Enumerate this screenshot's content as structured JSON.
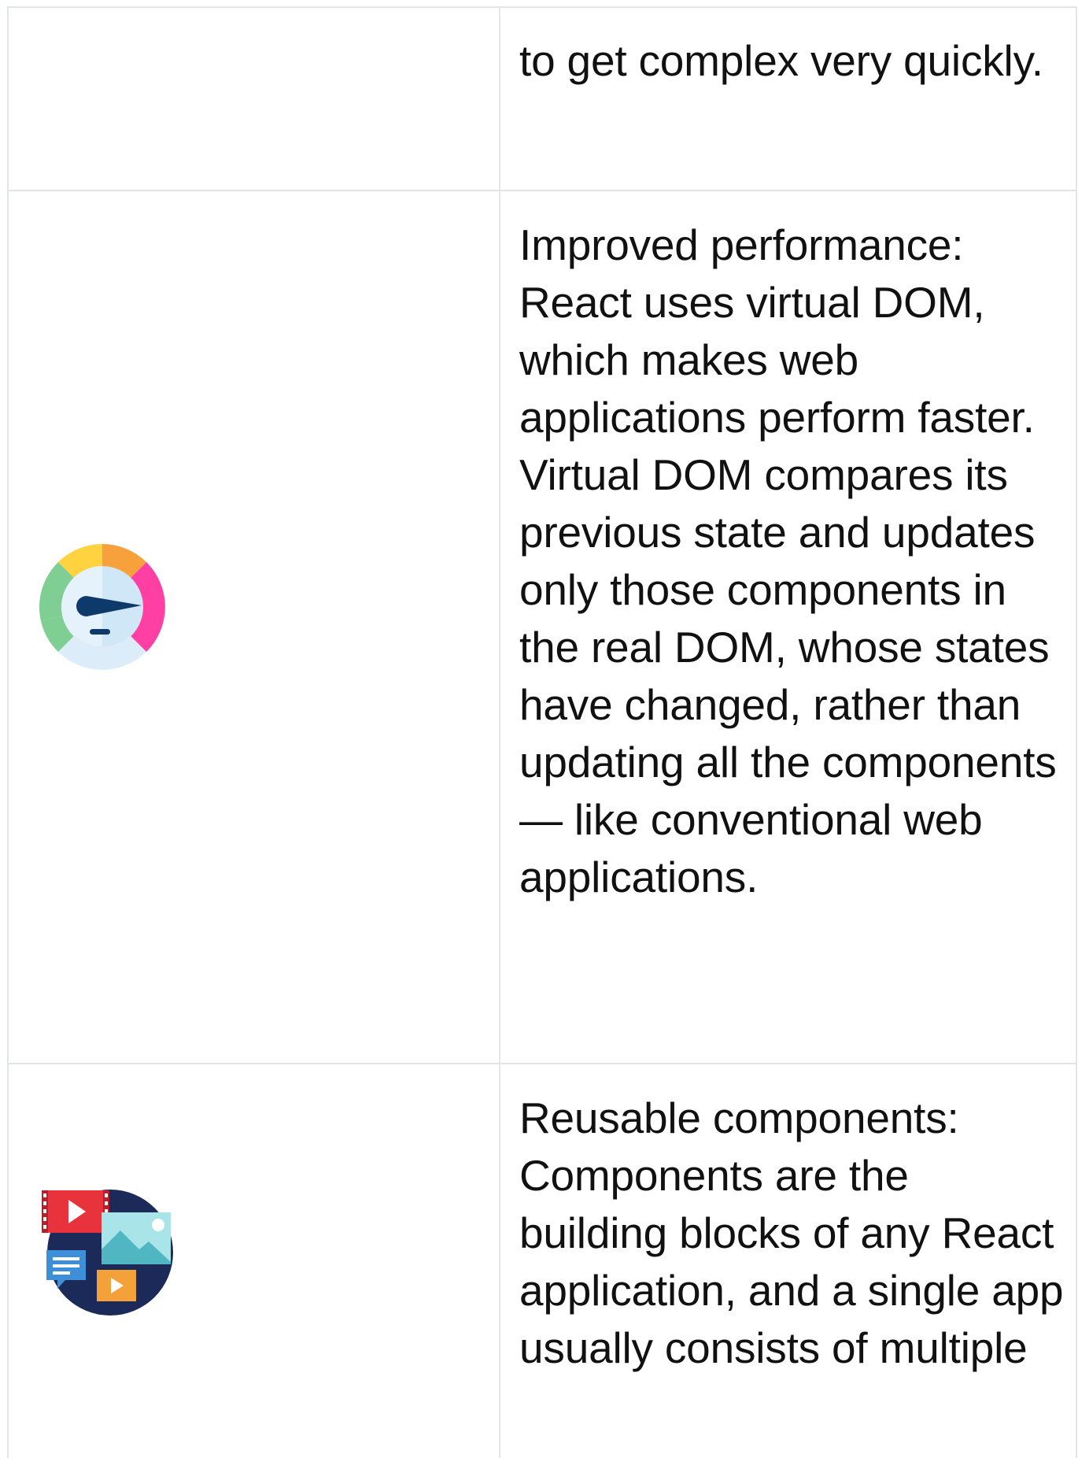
{
  "table": {
    "rows": [
      {
        "icon": "",
        "text": "to get complex very quickly."
      },
      {
        "icon": "speedometer-icon",
        "text": "Improved performance: React uses virtual DOM, which makes web applications perform faster. Virtual DOM compares its previous state and updates only those components in the real DOM, whose states have changed, rather than updating all the components — like conventional web applications."
      },
      {
        "icon": "media-content-icon",
        "text": "Reusable components: Components are the building blocks of any React application, and a single app usually consists of multiple"
      }
    ]
  },
  "colors": {
    "border": "#e3e6e8",
    "text": "#111111",
    "gauge_green": "#7fcf95",
    "gauge_yellow": "#ffd23f",
    "gauge_orange": "#f7a13c",
    "gauge_pink": "#ff3fa4",
    "gauge_center": "#cfe7f7",
    "needle": "#0d3a6b",
    "media_navy": "#1c2a5a",
    "media_red": "#e8333c",
    "media_teal": "#a9e4e8",
    "media_orange": "#f5a13a",
    "media_blue": "#3d8fd8"
  }
}
